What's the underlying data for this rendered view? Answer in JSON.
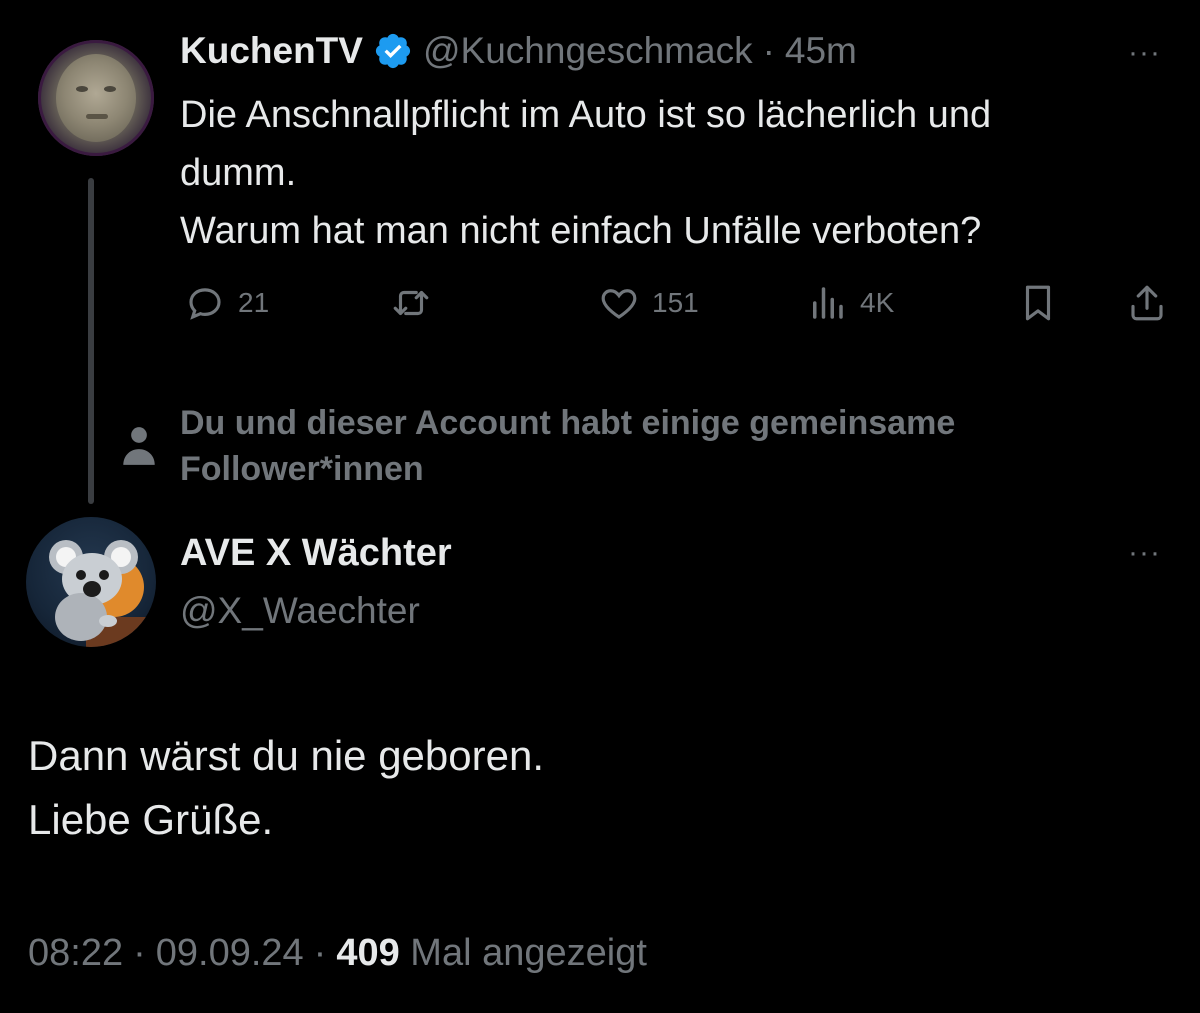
{
  "original_tweet": {
    "author_name": "KuchenTV",
    "handle": "@Kuchngeschmack",
    "separator": "·",
    "time_ago": "45m",
    "more_icon": "···",
    "text": "Die Anschnallpflicht im Auto ist so lächerlich und\ndumm.\nWarum hat man nicht einfach Unfälle verboten?",
    "actions": {
      "replies": "21",
      "retweets": "",
      "likes": "151",
      "views": "4K"
    }
  },
  "mutual_followers_notice": {
    "text": "Du und dieser Account habt einige gemeinsame\nFollower*innen"
  },
  "reply_tweet": {
    "author_name": "AVE X Wächter",
    "handle": "@X_Waechter",
    "more_icon": "···",
    "text": "Dann wärst du nie geboren.\nLiebe Grüße.",
    "time": "08:22",
    "date": "09.09.24",
    "separator": "·",
    "views_count": "409",
    "views_label": "Mal angezeigt"
  },
  "colors": {
    "background": "#000000",
    "text_primary": "#e7e9ea",
    "text_secondary": "#71767b",
    "verified_blue": "#1d9bf0"
  }
}
